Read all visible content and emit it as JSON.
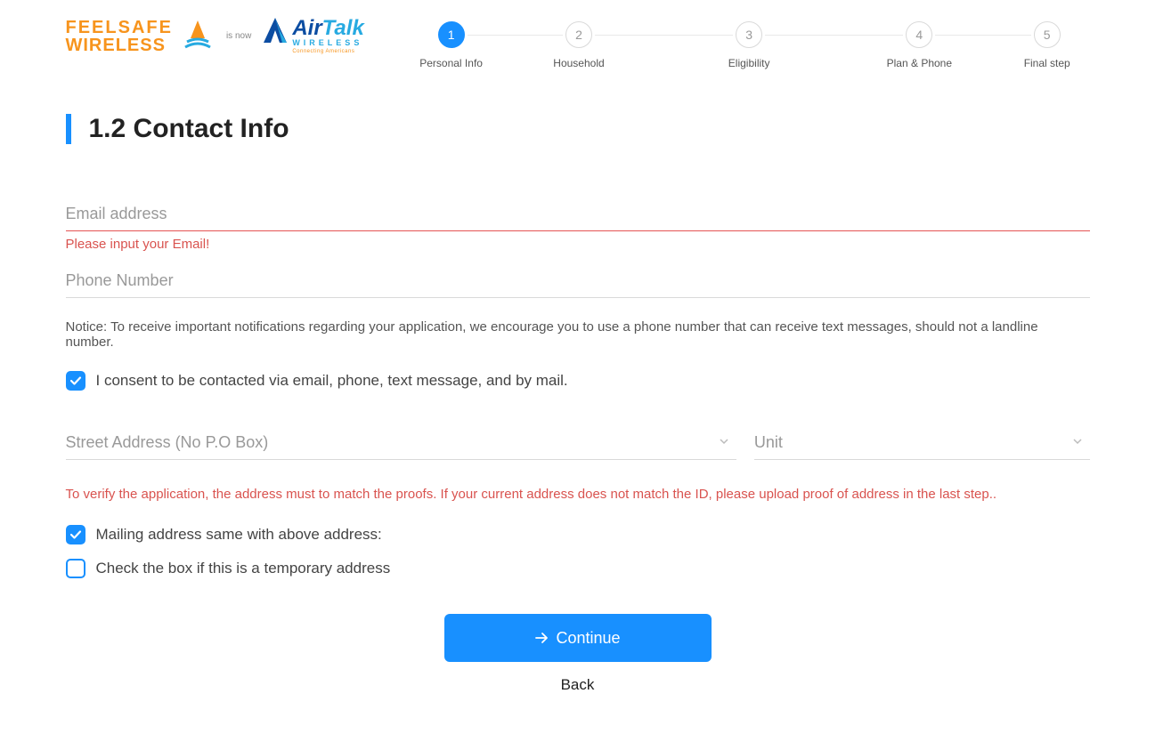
{
  "logo": {
    "feelsafe_line1": "FEELSAFE",
    "feelsafe_line2": "WIRELESS",
    "is_now": "is now",
    "airtalk_air": "Air",
    "airtalk_talk": "Talk",
    "airtalk_sub": "WIRELESS",
    "airtalk_tag": "Connecting Americans"
  },
  "stepper": {
    "steps": [
      {
        "num": "1",
        "label": "Personal Info",
        "active": true
      },
      {
        "num": "2",
        "label": "Household",
        "active": false
      },
      {
        "num": "3",
        "label": "Eligibility",
        "active": false
      },
      {
        "num": "4",
        "label": "Plan & Phone",
        "active": false
      },
      {
        "num": "5",
        "label": "Final step",
        "active": false
      }
    ]
  },
  "section": {
    "title": "1.2 Contact Info"
  },
  "form": {
    "email_placeholder": "Email address",
    "email_value": "",
    "email_error": "Please input your Email!",
    "phone_placeholder": "Phone Number",
    "phone_value": "",
    "notice": "Notice: To receive important notifications regarding your application, we encourage you to use a phone number that can receive text messages, should not a landline number.",
    "consent_label": "I consent to be contacted via email, phone, text message, and by mail.",
    "consent_checked": true,
    "street_placeholder": "Street Address (No P.O Box)",
    "street_value": "",
    "unit_placeholder": "Unit",
    "unit_value": "",
    "address_warning": "To verify the application, the address must to match the proofs. If your current address does not match the ID, please upload proof of address in the last step..",
    "mailing_same_label": "Mailing address same with above address:",
    "mailing_same_checked": true,
    "temp_label": "Check the box if this is a temporary address",
    "temp_checked": false
  },
  "actions": {
    "continue_label": "Continue",
    "back_label": "Back"
  }
}
